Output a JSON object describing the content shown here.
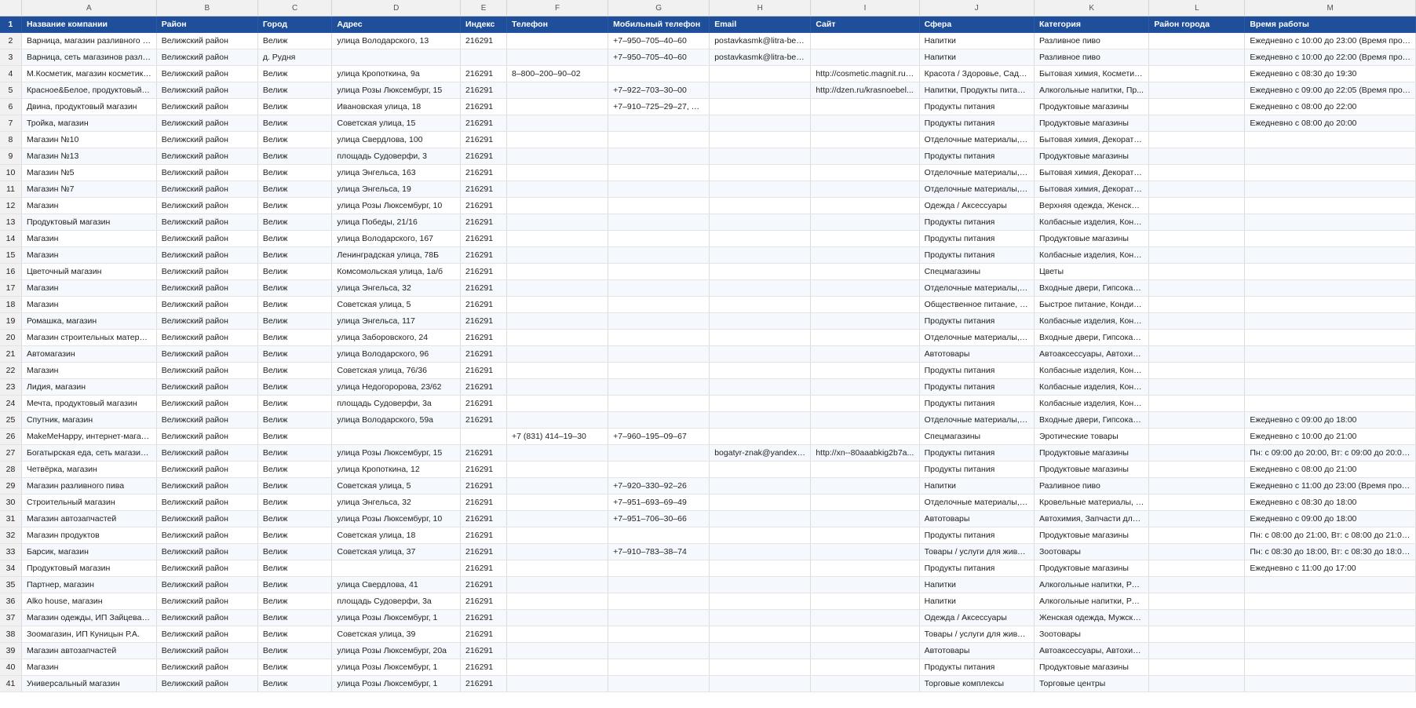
{
  "columns": [
    "A",
    "B",
    "C",
    "D",
    "E",
    "F",
    "G",
    "H",
    "I",
    "J",
    "K",
    "L",
    "M"
  ],
  "headers": [
    "Название компании",
    "Район",
    "Город",
    "Адрес",
    "Индекс",
    "Телефон",
    "Мобильный телефон",
    "Email",
    "Сайт",
    "Сфера",
    "Категория",
    "Район города",
    "Время работы"
  ],
  "rows": [
    {
      "n": "2",
      "cells": [
        "Варница, магазин разливного пива",
        "Велижский район",
        "Велиж",
        "улица Володарского, 13",
        "216291",
        "",
        "+7–950–705–40–60",
        "postavkasmk@litra-bee...",
        "",
        "Напитки",
        "Разливное пиво",
        "",
        "Ежедневно с 10:00 до 23:00 (Время прода..."
      ]
    },
    {
      "n": "3",
      "cells": [
        "Варница, сеть магазинов разливного ...",
        "Велижский район",
        "д. Рудня",
        "",
        "",
        "",
        "+7–950–705–40–60",
        "postavkasmk@litra-bee...",
        "",
        "Напитки",
        "Разливное пиво",
        "",
        "Ежедневно с 10:00 до 22:00 (Время прода..."
      ]
    },
    {
      "n": "4",
      "cells": [
        "М.Косметик, магазин косметики и бы...",
        "Велижский район",
        "Велиж",
        "улица Кропоткина, 9а",
        "216291",
        "8–800–200–90–02",
        "",
        "",
        "http://cosmetic.magnit.ru,...",
        "Красота / Здоровье, Садов...",
        "Бытовая химия, Косметика...",
        "",
        "Ежедневно с 08:30 до 19:30"
      ]
    },
    {
      "n": "5",
      "cells": [
        "Красное&Белое, продуктовый магазин",
        "Велижский район",
        "Велиж",
        "улица Розы Люксембург, 15",
        "216291",
        "",
        "+7–922–703–30–00",
        "",
        "http://dzen.ru/krasnoebel...",
        "Напитки, Продукты питания",
        "Алкогольные напитки, Пр...",
        "",
        "Ежедневно с 09:00 до 22:05 (Время прода..."
      ]
    },
    {
      "n": "6",
      "cells": [
        "Двина, продуктовый магазин",
        "Велижский район",
        "Велиж",
        "Ивановская улица, 18",
        "216291",
        "",
        "+7–910–725–29–27, +7...",
        "",
        "",
        "Продукты питания",
        "Продуктовые магазины",
        "",
        "Ежедневно с 08:00 до 22:00"
      ]
    },
    {
      "n": "7",
      "cells": [
        "Тройка, магазин",
        "Велижский район",
        "Велиж",
        "Советская улица, 15",
        "216291",
        "",
        "",
        "",
        "",
        "Продукты питания",
        "Продуктовые магазины",
        "",
        "Ежедневно с 08:00 до 20:00"
      ]
    },
    {
      "n": "8",
      "cells": [
        "Магазин №10",
        "Велижский район",
        "Велиж",
        "улица Свердлова, 100",
        "216291",
        "",
        "",
        "",
        "",
        "Отделочные материалы, С...",
        "Бытовая химия, Декоратив...",
        "",
        ""
      ]
    },
    {
      "n": "9",
      "cells": [
        "Магазин №13",
        "Велижский район",
        "Велиж",
        "площадь Судоверфи, 3",
        "216291",
        "",
        "",
        "",
        "",
        "Продукты питания",
        "Продуктовые магазины",
        "",
        ""
      ]
    },
    {
      "n": "10",
      "cells": [
        "Магазин №5",
        "Велижский район",
        "Велиж",
        "улица Энгельса, 163",
        "216291",
        "",
        "",
        "",
        "",
        "Отделочные материалы, С...",
        "Бытовая химия, Декоратив...",
        "",
        ""
      ]
    },
    {
      "n": "11",
      "cells": [
        "Магазин №7",
        "Велижский район",
        "Велиж",
        "улица Энгельса, 19",
        "216291",
        "",
        "",
        "",
        "",
        "Отделочные материалы, С...",
        "Бытовая химия, Декоратив...",
        "",
        ""
      ]
    },
    {
      "n": "12",
      "cells": [
        "Магазин",
        "Велижский район",
        "Велиж",
        "улица Розы Люксембург, 10",
        "216291",
        "",
        "",
        "",
        "",
        "Одежда / Аксессуары",
        "Верхняя одежда, Женская ...",
        "",
        ""
      ]
    },
    {
      "n": "13",
      "cells": [
        "Продуктовый магазин",
        "Велижский район",
        "Велиж",
        "улица Победы, 21/16",
        "216291",
        "",
        "",
        "",
        "",
        "Продукты питания",
        "Колбасные изделия, Конд...",
        "",
        ""
      ]
    },
    {
      "n": "14",
      "cells": [
        "Магазин",
        "Велижский район",
        "Велиж",
        "улица Володарского, 167",
        "216291",
        "",
        "",
        "",
        "",
        "Продукты питания",
        "Продуктовые магазины",
        "",
        ""
      ]
    },
    {
      "n": "15",
      "cells": [
        "Магазин",
        "Велижский район",
        "Велиж",
        "Ленинградская улица, 78Б",
        "216291",
        "",
        "",
        "",
        "",
        "Продукты питания",
        "Колбасные изделия, Конд...",
        "",
        ""
      ]
    },
    {
      "n": "16",
      "cells": [
        "Цветочный магазин",
        "Велижский район",
        "Велиж",
        "Комсомольская улица, 1а/б",
        "216291",
        "",
        "",
        "",
        "",
        "Спецмагазины",
        "Цветы",
        "",
        ""
      ]
    },
    {
      "n": "17",
      "cells": [
        "Магазин",
        "Велижский район",
        "Велиж",
        "улица Энгельса, 32",
        "216291",
        "",
        "",
        "",
        "",
        "Отделочные материалы, С...",
        "Входные двери, Гипсокарт...",
        "",
        ""
      ]
    },
    {
      "n": "18",
      "cells": [
        "Магазин",
        "Велижский район",
        "Велиж",
        "Советская улица, 5",
        "216291",
        "",
        "",
        "",
        "",
        "Общественное питание, П...",
        "Быстрое питание, Кондите...",
        "",
        ""
      ]
    },
    {
      "n": "19",
      "cells": [
        "Ромашка, магазин",
        "Велижский район",
        "Велиж",
        "улица Энгельса, 117",
        "216291",
        "",
        "",
        "",
        "",
        "Продукты питания",
        "Колбасные изделия, Конд...",
        "",
        ""
      ]
    },
    {
      "n": "20",
      "cells": [
        "Магазин строительных материалов",
        "Велижский район",
        "Велиж",
        "улица Заборовского, 24",
        "216291",
        "",
        "",
        "",
        "",
        "Отделочные материалы, С...",
        "Входные двери, Гипсокарт...",
        "",
        ""
      ]
    },
    {
      "n": "21",
      "cells": [
        "Автомагазин",
        "Велижский район",
        "Велиж",
        "улица Володарского, 96",
        "216291",
        "",
        "",
        "",
        "",
        "Автотовары",
        "Автоаксессуары, Автохими...",
        "",
        ""
      ]
    },
    {
      "n": "22",
      "cells": [
        "Магазин",
        "Велижский район",
        "Велиж",
        "Советская улица, 76/36",
        "216291",
        "",
        "",
        "",
        "",
        "Продукты питания",
        "Колбасные изделия, Конд...",
        "",
        ""
      ]
    },
    {
      "n": "23",
      "cells": [
        "Лидия, магазин",
        "Велижский район",
        "Велиж",
        "улица Недогоророва, 23/62",
        "216291",
        "",
        "",
        "",
        "",
        "Продукты питания",
        "Колбасные изделия, Конд...",
        "",
        ""
      ]
    },
    {
      "n": "24",
      "cells": [
        "Мечта, продуктовый магазин",
        "Велижский район",
        "Велиж",
        "площадь Судоверфи, 3а",
        "216291",
        "",
        "",
        "",
        "",
        "Продукты питания",
        "Колбасные изделия, Конд...",
        "",
        ""
      ]
    },
    {
      "n": "25",
      "cells": [
        "Спутник, магазин",
        "Велижский район",
        "Велиж",
        "улица Володарского, 59а",
        "216291",
        "",
        "",
        "",
        "",
        "Отделочные материалы, С...",
        "Входные двери, Гипсокарт...",
        "",
        "Ежедневно с 09:00 до 18:00"
      ]
    },
    {
      "n": "26",
      "cells": [
        "MakeMeHappy, интернет-магазин для...",
        "Велижский район",
        "Велиж",
        "",
        "",
        "+7 (831) 414–19–30",
        "+7–960–195–09–67",
        "",
        "",
        "Спецмагазины",
        "Эротические товары",
        "",
        "Ежедневно с 10:00 до 21:00"
      ]
    },
    {
      "n": "27",
      "cells": [
        "Богатырская еда, сеть магазинов",
        "Велижский район",
        "Велиж",
        "улица Розы Люксембург, 15",
        "216291",
        "",
        "",
        "bogatyr-znak@yandex.ru",
        "http://xn--80aaabkig2b7a...",
        "Продукты питания",
        "Продуктовые магазины",
        "",
        "Пн: с 09:00 до 20:00, Вт: с 09:00 до 20:00, С..."
      ]
    },
    {
      "n": "28",
      "cells": [
        "Четвёрка, магазин",
        "Велижский район",
        "Велиж",
        "улица Кропоткина, 12",
        "216291",
        "",
        "",
        "",
        "",
        "Продукты питания",
        "Продуктовые магазины",
        "",
        "Ежедневно с 08:00 до 21:00"
      ]
    },
    {
      "n": "29",
      "cells": [
        "Магазин разливного пива",
        "Велижский район",
        "Велиж",
        "Советская улица, 5",
        "216291",
        "",
        "+7–920–330–92–26",
        "",
        "",
        "Напитки",
        "Разливное пиво",
        "",
        "Ежедневно с 11:00 до 23:00 (Время прода..."
      ]
    },
    {
      "n": "30",
      "cells": [
        "Строительный магазин",
        "Велижский район",
        "Велиж",
        "улица Энгельса, 32",
        "216291",
        "",
        "+7–951–693–69–49",
        "",
        "",
        "Отделочные материалы, С...",
        "Кровельные материалы, Л...",
        "",
        "Ежедневно с 08:30 до 18:00"
      ]
    },
    {
      "n": "31",
      "cells": [
        "Магазин автозапчастей",
        "Велижский район",
        "Велиж",
        "улица Розы Люксембург, 10",
        "216291",
        "",
        "+7–951–706–30–66",
        "",
        "",
        "Автотовары",
        "Автохимия, Запчасти для и...",
        "",
        "Ежедневно с 09:00 до 18:00"
      ]
    },
    {
      "n": "32",
      "cells": [
        "Магазин продуктов",
        "Велижский район",
        "Велиж",
        "Советская улица, 18",
        "216291",
        "",
        "",
        "",
        "",
        "Продукты питания",
        "Продуктовые магазины",
        "",
        "Пн: с 08:00 до 21:00, Вт: с 08:00 до 21:00, С..."
      ]
    },
    {
      "n": "33",
      "cells": [
        "Барсик, магазин",
        "Велижский район",
        "Велиж",
        "Советская улица, 37",
        "216291",
        "",
        "+7–910–783–38–74",
        "",
        "",
        "Товары / услуги для живот...",
        "Зоотовары",
        "",
        "Пн: с 08:30 до 18:00, Вт: с 08:30 до 18:00, С..."
      ]
    },
    {
      "n": "34",
      "cells": [
        "Продуктовый магазин",
        "Велижский район",
        "Велиж",
        "",
        "216291",
        "",
        "",
        "",
        "",
        "Продукты питания",
        "Продуктовые магазины",
        "",
        "Ежедневно с 11:00 до 17:00"
      ]
    },
    {
      "n": "35",
      "cells": [
        "Партнер, магазин",
        "Велижский район",
        "Велиж",
        "улица Свердлова, 41",
        "216291",
        "",
        "",
        "",
        "",
        "Напитки",
        "Алкогольные напитки, Раз...",
        "",
        ""
      ]
    },
    {
      "n": "36",
      "cells": [
        "Alko house, магазин",
        "Велижский район",
        "Велиж",
        "площадь Судоверфи, 3а",
        "216291",
        "",
        "",
        "",
        "",
        "Напитки",
        "Алкогольные напитки, Раз...",
        "",
        ""
      ]
    },
    {
      "n": "37",
      "cells": [
        "Магазин одежды, ИП Зайцева Н.М.",
        "Велижский район",
        "Велиж",
        "улица Розы Люксембург, 1",
        "216291",
        "",
        "",
        "",
        "",
        "Одежда / Аксессуары",
        "Женская одежда, Мужская...",
        "",
        ""
      ]
    },
    {
      "n": "38",
      "cells": [
        "Зоомагазин, ИП Куницын Р.А.",
        "Велижский район",
        "Велиж",
        "Советская улица, 39",
        "216291",
        "",
        "",
        "",
        "",
        "Товары / услуги для живот...",
        "Зоотовары",
        "",
        ""
      ]
    },
    {
      "n": "39",
      "cells": [
        "Магазин автозапчастей",
        "Велижский район",
        "Велиж",
        "улица Розы Люксембург, 20а",
        "216291",
        "",
        "",
        "",
        "",
        "Автотовары",
        "Автоаксессуары, Автохими...",
        "",
        ""
      ]
    },
    {
      "n": "40",
      "cells": [
        "Магазин",
        "Велижский район",
        "Велиж",
        "улица Розы Люксембург, 1",
        "216291",
        "",
        "",
        "",
        "",
        "Продукты питания",
        "Продуктовые магазины",
        "",
        ""
      ]
    },
    {
      "n": "41",
      "cells": [
        "Универсальный магазин",
        "Велижский район",
        "Велиж",
        "улица Розы Люксембург, 1",
        "216291",
        "",
        "",
        "",
        "",
        "Торговые комплексы",
        "Торговые центры",
        "",
        ""
      ]
    }
  ]
}
